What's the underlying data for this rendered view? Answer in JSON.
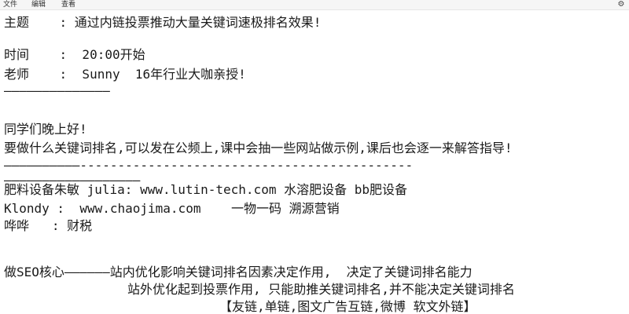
{
  "menu": {
    "file": "文件",
    "edit": "编辑",
    "view": "查看"
  },
  "icons": {
    "settings": "gear-icon"
  },
  "editor": {
    "lines": [
      "主题    : 通过内链投票推动大量关键词速极排名效果!",
      "时间    :  20:00开始",
      "老师    :  Sunny  16年行业大咖亲授!",
      "——————————————",
      "同学们晚上好!",
      "要做什么关键词排名,可以发在公频上,课中会抽一些网站做示例,课后也会逐一来解答指导!",
      "——————————--------------------------------------------",
      "——————————————————",
      "肥料设备朱敏 julia: www.lutin-tech.com 水溶肥设备 bb肥设备",
      "Klondy :  www.chaojima.com    一物一码 溯源营销",
      "哗哗   : 财税",
      "做SEO核心——————站内优化影响关键词排名因素决定作用,  决定了关键词排名能力",
      "站外优化起到投票作用, 只能助推关键词排名,并不能决定关键词排名",
      "【友链,单链,图文广告互链,微博 软文外链】"
    ]
  }
}
